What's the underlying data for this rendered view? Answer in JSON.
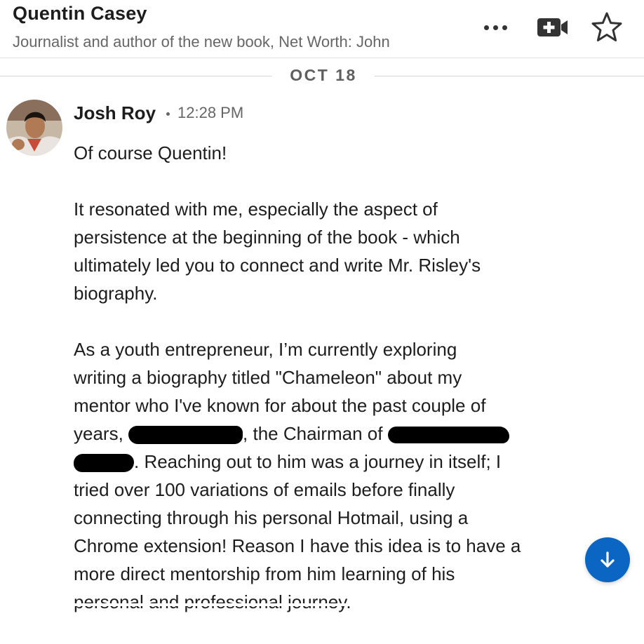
{
  "header": {
    "contact_name": "Quentin Casey",
    "headline": "Journalist and author of the new book, Net Worth: John",
    "icons": [
      "more-icon",
      "video-call-icon",
      "star-icon"
    ]
  },
  "conversation": {
    "date_label": "OCT 18",
    "message": {
      "sender": "Josh Roy",
      "timestamp": "12:28 PM",
      "avatar_icon": "user-avatar",
      "paragraphs": {
        "p1": "Of course Quentin!",
        "p2": {
          "l1": "It resonated with me, especially the aspect of",
          "l2": "persistence at the beginning of the book - which",
          "l3": "ultimately led you to connect and write Mr. Risley's",
          "l4": "biography."
        },
        "p3": {
          "l1": "As a youth entrepreneur, I’m currently exploring",
          "l2": "writing a biography titled \"Chameleon\" about my",
          "l3": "mentor who I've known for about the past couple of",
          "l4a": "years, ",
          "l4b": ", the Chairman of ",
          "l5": ". Reaching out to him was a journey in itself; I",
          "l6": "tried over 100 variations of emails before finally",
          "l7": "connecting through his personal Hotmail, using a",
          "l8": "Chrome extension! Reason I have this idea is to have a",
          "l9": "more direct mentorship from him learning of his",
          "l10": "personal and professional journey."
        }
      }
    }
  },
  "scroll_button": {
    "icon": "arrow-down-icon",
    "color": "#0a66c2"
  },
  "colors": {
    "accent": "#0a66c2",
    "text": "#1d1d1d",
    "muted": "#666666",
    "redaction": "#000000"
  }
}
